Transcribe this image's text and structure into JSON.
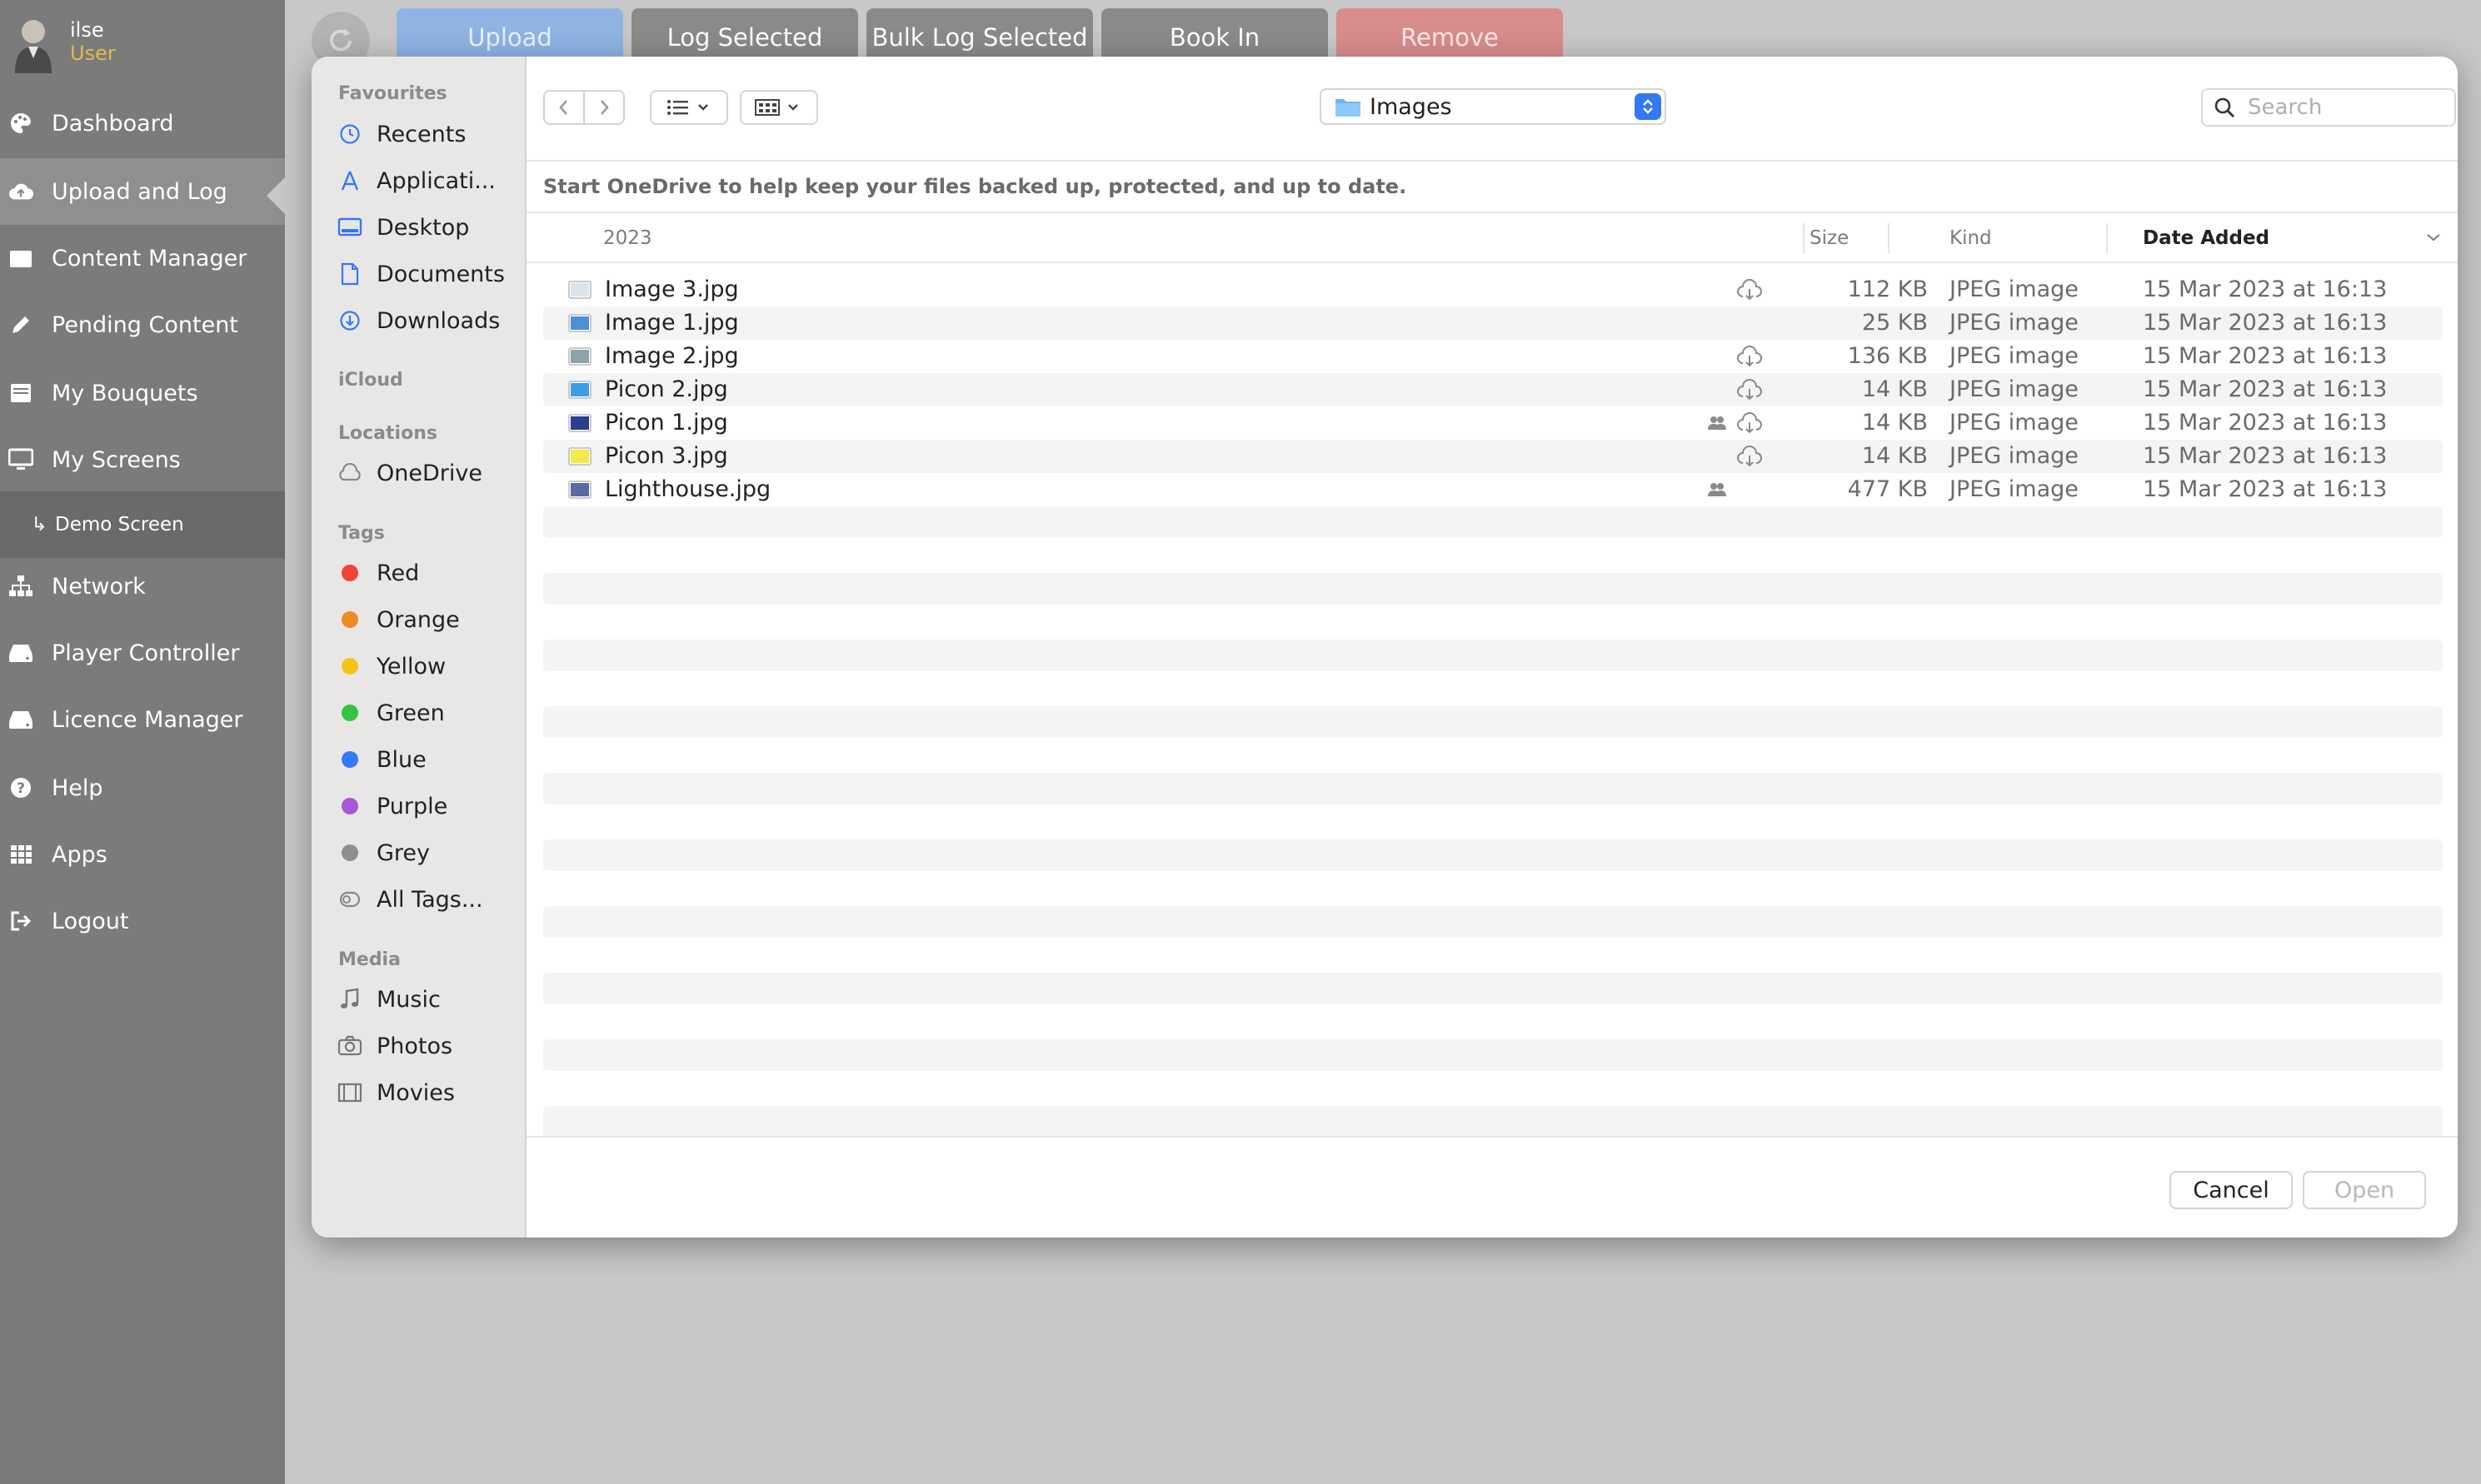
{
  "user": {
    "name": "ilse",
    "role": "User"
  },
  "nav": {
    "items": [
      {
        "label": "Dashboard",
        "icon": "palette-icon"
      },
      {
        "label": "Upload and Log",
        "icon": "cloud-upload-icon"
      },
      {
        "label": "Content Manager",
        "icon": "folder-icon"
      },
      {
        "label": "Pending Content",
        "icon": "pencil-icon"
      },
      {
        "label": "My Bouquets",
        "icon": "list-box-icon"
      },
      {
        "label": "My Screens",
        "icon": "monitor-icon"
      },
      {
        "label": "Demo Screen",
        "icon": "sub-arrow-icon"
      },
      {
        "label": "Network",
        "icon": "sitemap-icon"
      },
      {
        "label": "Player Controller",
        "icon": "hdd-icon"
      },
      {
        "label": "Licence Manager",
        "icon": "hdd-icon"
      },
      {
        "label": "Help",
        "icon": "question-icon"
      },
      {
        "label": "Apps",
        "icon": "grid-icon"
      },
      {
        "label": "Logout",
        "icon": "logout-icon"
      }
    ],
    "sub_prefix": "↳"
  },
  "toolbar_tabs": [
    {
      "label": "Upload",
      "color": "#8fb4e3",
      "text_color": "#eaf1fb"
    },
    {
      "label": "Log Selected",
      "color": "#8a8a8a",
      "text_color": "#ffffff"
    },
    {
      "label": "Bulk Log Selected",
      "color": "#8a8a8a",
      "text_color": "#ffffff"
    },
    {
      "label": "Book In",
      "color": "#8a8a8a",
      "text_color": "#ffffff"
    },
    {
      "label": "Remove",
      "color": "#d98c8c",
      "text_color": "#fbe9e9"
    }
  ],
  "dialog": {
    "sidebar": {
      "favourites_title": "Favourites",
      "favourites": [
        {
          "label": "Recents",
          "icon": "clock-icon"
        },
        {
          "label": "Applicati...",
          "icon": "applications-icon"
        },
        {
          "label": "Desktop",
          "icon": "desktop-icon"
        },
        {
          "label": "Documents",
          "icon": "document-icon"
        },
        {
          "label": "Downloads",
          "icon": "download-icon"
        }
      ],
      "icloud_title": "iCloud",
      "locations_title": "Locations",
      "locations": [
        {
          "label": "OneDrive",
          "icon": "cloud-icon"
        }
      ],
      "tags_title": "Tags",
      "tags": [
        {
          "label": "Red",
          "color": "#f0443a"
        },
        {
          "label": "Orange",
          "color": "#f08a24"
        },
        {
          "label": "Yellow",
          "color": "#f5c516"
        },
        {
          "label": "Green",
          "color": "#35c43f"
        },
        {
          "label": "Blue",
          "color": "#2f7cf6"
        },
        {
          "label": "Purple",
          "color": "#a558d6"
        },
        {
          "label": "Grey",
          "color": "#8e8e93"
        }
      ],
      "all_tags": "All Tags...",
      "media_title": "Media",
      "media": [
        {
          "label": "Music",
          "icon": "music-icon"
        },
        {
          "label": "Photos",
          "icon": "camera-icon"
        },
        {
          "label": "Movies",
          "icon": "film-icon"
        }
      ]
    },
    "location": "Images",
    "search_placeholder": "Search",
    "banner": "Start OneDrive to help keep your files backed up, protected, and up to date.",
    "columns": {
      "group": "2023",
      "size": "Size",
      "kind": "Kind",
      "date": "Date Added"
    },
    "files": [
      {
        "name": "Image 3.jpg",
        "size": "112 KB",
        "kind": "JPEG image",
        "date": "15 Mar 2023 at 16:13",
        "cloud": true,
        "shared": false,
        "thumb": "#d9e6ee"
      },
      {
        "name": "Image 1.jpg",
        "size": "25 KB",
        "kind": "JPEG image",
        "date": "15 Mar 2023 at 16:13",
        "cloud": false,
        "shared": false,
        "thumb": "#4c8fd6"
      },
      {
        "name": "Image 2.jpg",
        "size": "136 KB",
        "kind": "JPEG image",
        "date": "15 Mar 2023 at 16:13",
        "cloud": true,
        "shared": false,
        "thumb": "#8aa3ad"
      },
      {
        "name": "Picon 2.jpg",
        "size": "14 KB",
        "kind": "JPEG image",
        "date": "15 Mar 2023 at 16:13",
        "cloud": true,
        "shared": false,
        "thumb": "#3d9ee8"
      },
      {
        "name": "Picon 1.jpg",
        "size": "14 KB",
        "kind": "JPEG image",
        "date": "15 Mar 2023 at 16:13",
        "cloud": true,
        "shared": true,
        "thumb": "#2a3f8f"
      },
      {
        "name": "Picon 3.jpg",
        "size": "14 KB",
        "kind": "JPEG image",
        "date": "15 Mar 2023 at 16:13",
        "cloud": true,
        "shared": false,
        "thumb": "#f6ea4a"
      },
      {
        "name": "Lighthouse.jpg",
        "size": "477 KB",
        "kind": "JPEG image",
        "date": "15 Mar 2023 at 16:13",
        "cloud": false,
        "shared": true,
        "thumb": "#5b6aa0"
      }
    ],
    "cancel_label": "Cancel",
    "open_label": "Open"
  }
}
